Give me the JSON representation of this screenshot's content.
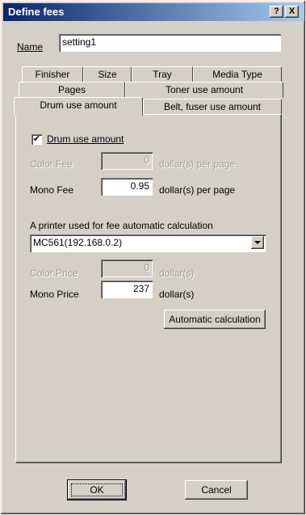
{
  "window": {
    "title": "Define fees",
    "help_button": "?",
    "close_button": "X"
  },
  "name_field": {
    "label": "Name",
    "value": "setting1"
  },
  "tabs": {
    "row1": [
      "Finisher",
      "Size",
      "Tray",
      "Media Type"
    ],
    "row2": [
      "Pages",
      "Toner use amount"
    ],
    "row3": [
      "Drum use amount",
      "Belt, fuser use amount"
    ],
    "active": "Drum use amount"
  },
  "drum_panel": {
    "checkbox_label": "Drum use amount",
    "checkbox_checked": true,
    "checkbox_mark": "✔",
    "color_fee_label": "Color Fee",
    "color_fee_value": "0",
    "color_fee_unit": "dollar(s) per page",
    "mono_fee_label": "Mono Fee",
    "mono_fee_value": "0.95",
    "mono_fee_unit": "dollar(s) per page",
    "printer_label": "A printer used for fee automatic calculation",
    "printer_value": "MC561(192.168.0.2)",
    "color_price_label": "Color Price",
    "color_price_value": "0",
    "color_price_unit": "dollar(s)",
    "mono_price_label": "Mono Price",
    "mono_price_value": "237",
    "mono_price_unit": "dollar(s)",
    "auto_calc_button": "Automatic calculation"
  },
  "footer": {
    "ok_button": "OK",
    "cancel_button": "Cancel"
  }
}
